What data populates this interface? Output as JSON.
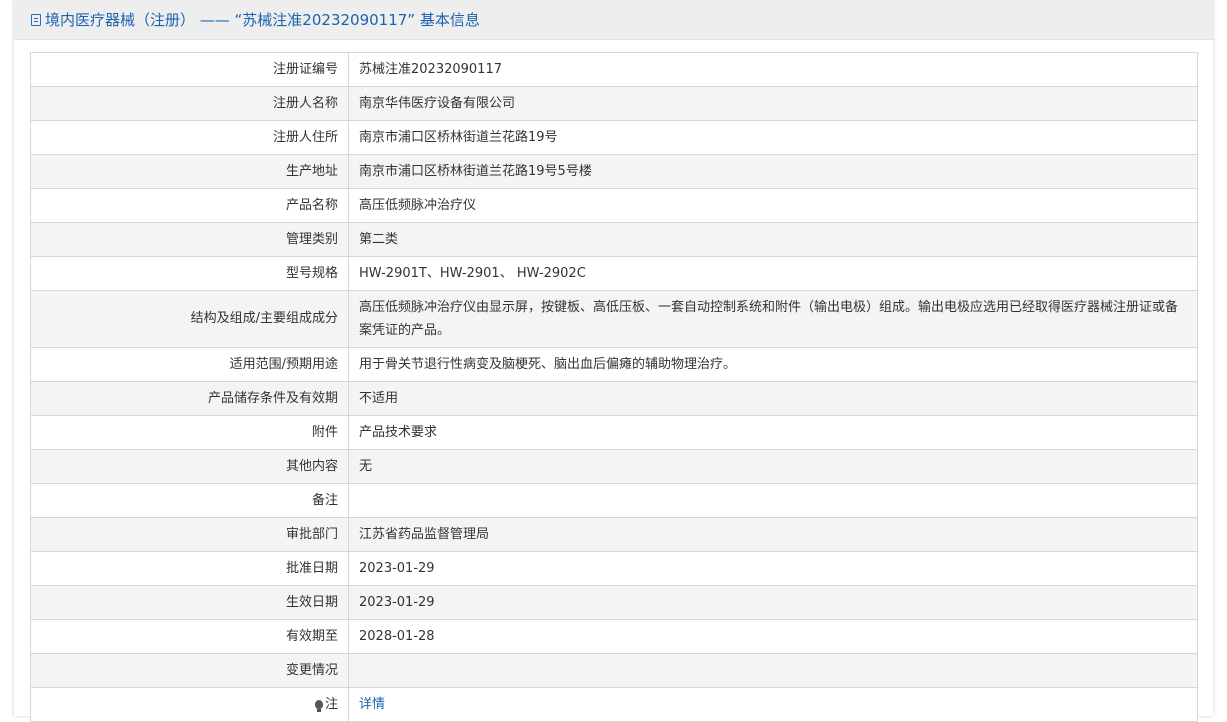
{
  "header": {
    "title": "境内医疗器械（注册） —— “苏械注准20232090117” 基本信息",
    "icon": "document-icon"
  },
  "rows": [
    {
      "label": "注册证编号",
      "value": "苏械注准20232090117"
    },
    {
      "label": "注册人名称",
      "value": "南京华伟医疗设备有限公司"
    },
    {
      "label": "注册人住所",
      "value": "南京市浦口区桥林街道兰花路19号"
    },
    {
      "label": "生产地址",
      "value": "南京市浦口区桥林街道兰花路19号5号楼"
    },
    {
      "label": "产品名称",
      "value": "高压低频脉冲治疗仪"
    },
    {
      "label": "管理类别",
      "value": "第二类"
    },
    {
      "label": "型号规格",
      "value": "HW-2901T、HW-2901、 HW-2902C"
    },
    {
      "label": "结构及组成/主要组成成分",
      "value": "高压低频脉冲治疗仪由显示屏，按键板、高低压板、一套自动控制系统和附件（输出电极）组成。输出电极应选用已经取得医疗器械注册证或备案凭证的产品。"
    },
    {
      "label": "适用范围/预期用途",
      "value": "用于骨关节退行性病变及脑梗死、脑出血后偏瘫的辅助物理治疗。"
    },
    {
      "label": "产品储存条件及有效期",
      "value": "不适用"
    },
    {
      "label": "附件",
      "value": "产品技术要求"
    },
    {
      "label": "其他内容",
      "value": "无"
    },
    {
      "label": "备注",
      "value": ""
    },
    {
      "label": "审批部门",
      "value": "江苏省药品监督管理局"
    },
    {
      "label": "批准日期",
      "value": "2023-01-29"
    },
    {
      "label": "生效日期",
      "value": "2023-01-29"
    },
    {
      "label": "有效期至",
      "value": "2028-01-28"
    },
    {
      "label": "变更情况",
      "value": ""
    },
    {
      "label": "注",
      "value": "详情",
      "icon": "lightbulb-icon"
    }
  ],
  "colors": {
    "accent": "#1a63b0",
    "header_bg": "#eeeeee",
    "border": "#d6d6d6"
  }
}
